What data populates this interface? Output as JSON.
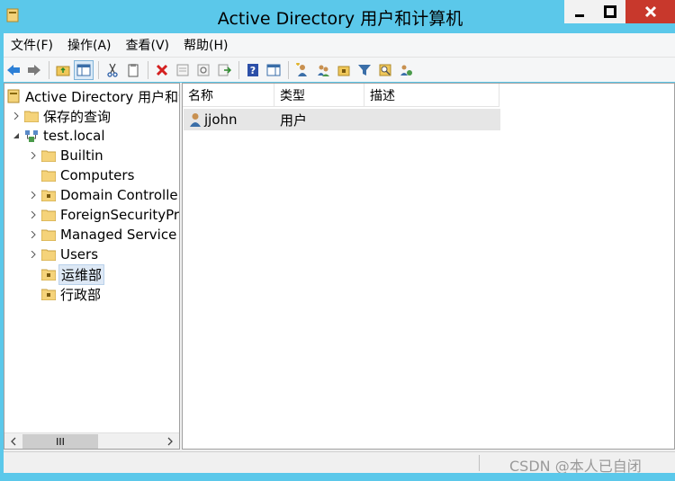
{
  "window": {
    "title": "Active Directory 用户和计算机",
    "controls": [
      "minimize",
      "maximize",
      "close"
    ]
  },
  "menu": [
    "文件(F)",
    "操作(A)",
    "查看(V)",
    "帮助(H)"
  ],
  "toolbar": {
    "buttons": [
      "back",
      "forward",
      "up-folder",
      "show-console-tree",
      "cut",
      "copy",
      "delete",
      "properties",
      "refresh",
      "export-list",
      "help",
      "show-action-pane",
      "new-user",
      "new-group",
      "new-ou",
      "filter",
      "find",
      "add-to-group"
    ]
  },
  "tree": {
    "root": "Active Directory 用户和计算机",
    "items": [
      {
        "label": "保存的查询",
        "level": 1,
        "expander": "collapsed",
        "icon": "folder"
      },
      {
        "label": "test.local",
        "level": 1,
        "expander": "expanded",
        "icon": "domain"
      },
      {
        "label": "Builtin",
        "level": 2,
        "expander": "collapsed",
        "icon": "folder"
      },
      {
        "label": "Computers",
        "level": 2,
        "expander": "none",
        "icon": "folder"
      },
      {
        "label": "Domain Controllers",
        "level": 2,
        "expander": "collapsed",
        "icon": "ou"
      },
      {
        "label": "ForeignSecurityPrincipals",
        "level": 2,
        "expander": "collapsed",
        "icon": "folder"
      },
      {
        "label": "Managed Service Accounts",
        "level": 2,
        "expander": "collapsed",
        "icon": "folder"
      },
      {
        "label": "Users",
        "level": 2,
        "expander": "collapsed",
        "icon": "folder"
      },
      {
        "label": "运维部",
        "level": 2,
        "expander": "none",
        "icon": "ou",
        "selected": true
      },
      {
        "label": "行政部",
        "level": 2,
        "expander": "none",
        "icon": "ou"
      }
    ],
    "scrollbar_thumb": "III"
  },
  "list": {
    "columns": [
      "名称",
      "类型",
      "描述"
    ],
    "rows": [
      {
        "name": "jjohn",
        "type": "用户",
        "description": ""
      }
    ]
  },
  "status": {
    "watermark": "CSDN @本人已自闭"
  },
  "colors": {
    "titlebar": "#5bc8ea",
    "close": "#c8382c",
    "selection": "#dde8f5"
  }
}
